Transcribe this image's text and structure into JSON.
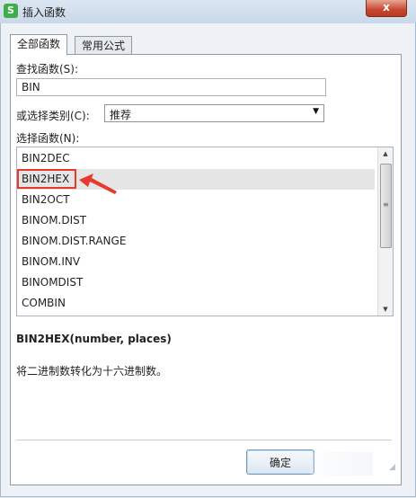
{
  "window": {
    "title": "插入函数",
    "app_icon_glyph": "S",
    "close_glyph": "x"
  },
  "tabs": [
    {
      "label": "全部函数",
      "active": true
    },
    {
      "label": "常用公式",
      "active": false
    }
  ],
  "search": {
    "label": "查找函数(S):",
    "value": "BIN"
  },
  "category": {
    "label": "或选择类别(C):",
    "selected": "推荐"
  },
  "function_list": {
    "label": "选择函数(N):",
    "items": [
      "BIN2DEC",
      "BIN2HEX",
      "BIN2OCT",
      "BINOM.DIST",
      "BINOM.DIST.RANGE",
      "BINOM.INV",
      "BINOMDIST",
      "COMBIN"
    ],
    "selected": "BIN2HEX"
  },
  "description": {
    "signature": "BIN2HEX(number, places)",
    "text": "将二进制数转化为十六进制数。"
  },
  "buttons": {
    "ok": "确定"
  },
  "colors": {
    "highlight": "#e53a2c",
    "close_button": "#c7472e",
    "selected_row": "#e5e5e5"
  }
}
